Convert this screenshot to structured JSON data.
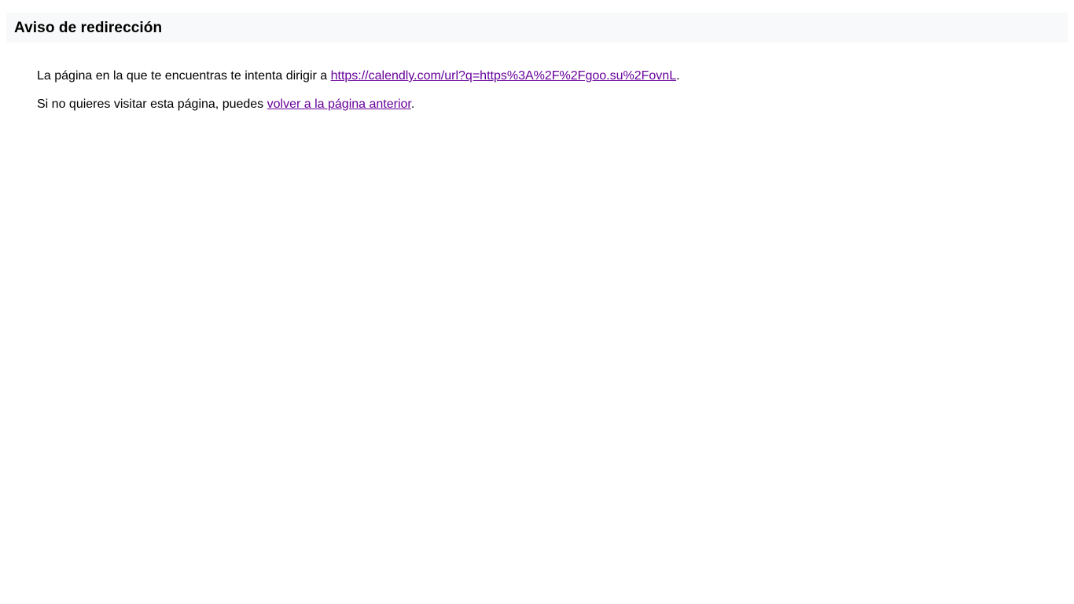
{
  "header": {
    "title": "Aviso de redirección"
  },
  "main": {
    "redirect_line": {
      "prefix": "La página en la que te encuentras te intenta dirigir a ",
      "link_text": "https://calendly.com/url?q=https%3A%2F%2Fgoo.su%2FovnL",
      "suffix": "."
    },
    "back_line": {
      "prefix": "Si no quieres visitar esta página, puedes ",
      "link_text": "volver a la página anterior",
      "suffix": "."
    }
  },
  "colors": {
    "header_background": "#f8f9fa",
    "link": "#660099",
    "text": "#000000",
    "page_background": "#ffffff"
  }
}
